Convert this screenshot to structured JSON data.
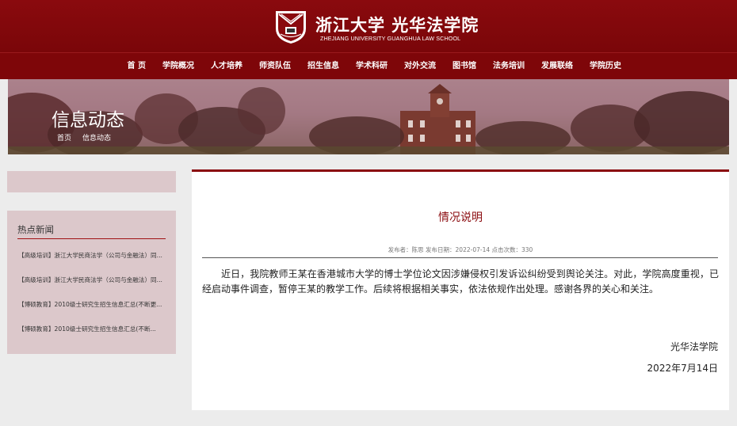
{
  "header": {
    "logo_cn": "浙江大学 光华法学院",
    "logo_en": "ZHEJIANG UNIVERSITY GUANGHUA LAW SCHOOL"
  },
  "nav": {
    "items": [
      {
        "label": "首 页"
      },
      {
        "label": "学院概况"
      },
      {
        "label": "人才培养"
      },
      {
        "label": "师资队伍"
      },
      {
        "label": "招生信息"
      },
      {
        "label": "学术科研"
      },
      {
        "label": "对外交流"
      },
      {
        "label": "图书馆"
      },
      {
        "label": "法务培训"
      },
      {
        "label": "发展联络"
      },
      {
        "label": "学院历史"
      }
    ]
  },
  "banner": {
    "title": "信息动态",
    "breadcrumb": [
      "首页",
      "信息动态"
    ]
  },
  "sidebar": {
    "hot_title": "热点新闻",
    "hot_items": [
      "【高级培训】浙江大学民商法学（公司与金融法）同...",
      "【高级培训】浙江大学民商法学（公司与金融法）同...",
      "【博硕教育】2010级士研究生招生信息汇总(不断更...",
      "【博硕教育】2010级士研究生招生信息汇总(不断..."
    ]
  },
  "article": {
    "title": "情况说明",
    "meta": "发布者：陈思   发布日期：2022-07-14  点击次数：330",
    "body": "近日，我院教师王某在香港城市大学的博士学位论文因涉嫌侵权引发诉讼纠纷受到舆论关注。对此，学院高度重视，已经启动事件调查，暂停王某的教学工作。后续将根据相关事实，依法依规作出处理。感谢各界的关心和关注。",
    "signature": "光华法学院",
    "date": "2022年7月14日"
  },
  "colors": {
    "brand": "#8a0a0e",
    "nav_bg": "#7e0609",
    "side_bg": "#dcc8cb"
  }
}
